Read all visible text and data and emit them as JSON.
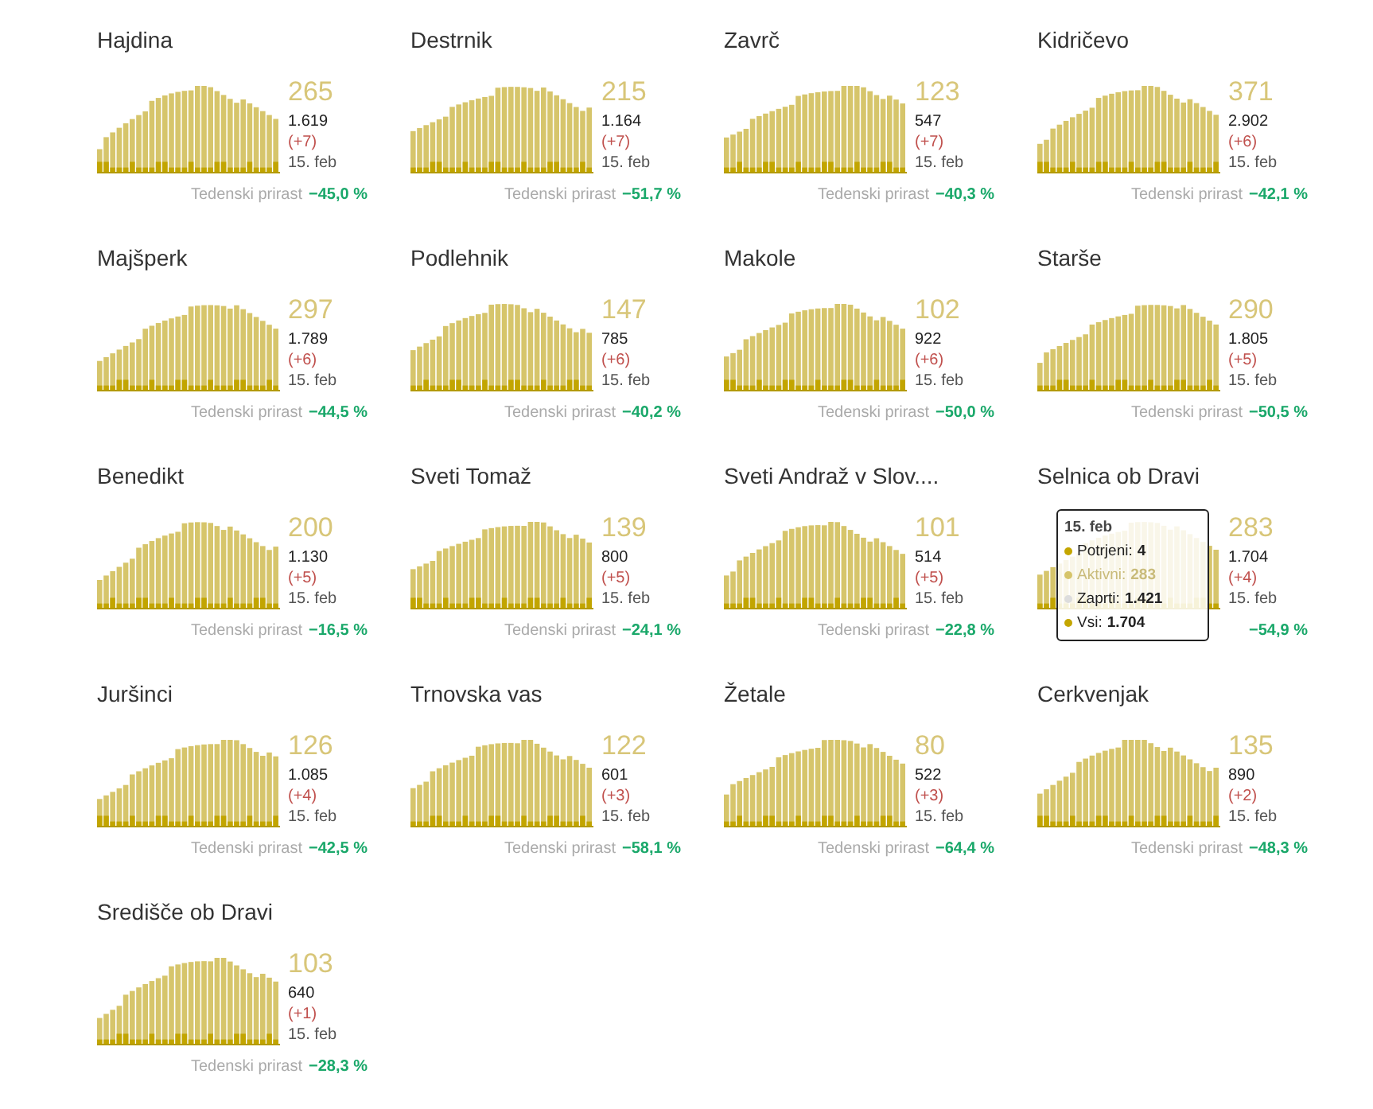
{
  "cards": [
    {
      "title": "Hajdina",
      "active": "265",
      "total": "1.619",
      "delta": "(+7)",
      "date": "15. feb",
      "growth_label": "Tedenski prirast",
      "growth": "−45,0 %"
    },
    {
      "title": "Destrnik",
      "active": "215",
      "total": "1.164",
      "delta": "(+7)",
      "date": "15. feb",
      "growth_label": "Tedenski prirast",
      "growth": "−51,7 %"
    },
    {
      "title": "Zavrč",
      "active": "123",
      "total": "547",
      "delta": "(+7)",
      "date": "15. feb",
      "growth_label": "Tedenski prirast",
      "growth": "−40,3 %"
    },
    {
      "title": "Kidričevo",
      "active": "371",
      "total": "2.902",
      "delta": "(+6)",
      "date": "15. feb",
      "growth_label": "Tedenski prirast",
      "growth": "−42,1 %"
    },
    {
      "title": "Majšperk",
      "active": "297",
      "total": "1.789",
      "delta": "(+6)",
      "date": "15. feb",
      "growth_label": "Tedenski prirast",
      "growth": "−44,5 %"
    },
    {
      "title": "Podlehnik",
      "active": "147",
      "total": "785",
      "delta": "(+6)",
      "date": "15. feb",
      "growth_label": "Tedenski prirast",
      "growth": "−40,2 %"
    },
    {
      "title": "Makole",
      "active": "102",
      "total": "922",
      "delta": "(+6)",
      "date": "15. feb",
      "growth_label": "Tedenski prirast",
      "growth": "−50,0 %"
    },
    {
      "title": "Starše",
      "active": "290",
      "total": "1.805",
      "delta": "(+5)",
      "date": "15. feb",
      "growth_label": "Tedenski prirast",
      "growth": "−50,5 %"
    },
    {
      "title": "Benedikt",
      "active": "200",
      "total": "1.130",
      "delta": "(+5)",
      "date": "15. feb",
      "growth_label": "Tedenski prirast",
      "growth": "−16,5 %"
    },
    {
      "title": "Sveti Tomaž",
      "active": "139",
      "total": "800",
      "delta": "(+5)",
      "date": "15. feb",
      "growth_label": "Tedenski prirast",
      "growth": "−24,1 %"
    },
    {
      "title": "Sveti Andraž v Slov....",
      "active": "101",
      "total": "514",
      "delta": "(+5)",
      "date": "15. feb",
      "growth_label": "Tedenski prirast",
      "growth": "−22,8 %"
    },
    {
      "title": "Selnica ob Dravi",
      "active": "283",
      "total": "1.704",
      "delta": "(+4)",
      "date": "15. feb",
      "growth": "−54,9 %",
      "tooltip": {
        "date": "15. feb",
        "rows": [
          {
            "label": "Potrjeni:",
            "value": "4",
            "color": "#c4a600",
            "faded": false
          },
          {
            "label": "Aktivni:",
            "value": "283",
            "color": "#d6c46a",
            "faded": true
          },
          {
            "label": "Zaprti:",
            "value": "1.421",
            "color": "#dddddd",
            "faded": false
          },
          {
            "label": "Vsi:",
            "value": "1.704",
            "color": "#c4a600",
            "faded": false
          }
        ]
      }
    },
    {
      "title": "Juršinci",
      "active": "126",
      "total": "1.085",
      "delta": "(+4)",
      "date": "15. feb",
      "growth_label": "Tedenski prirast",
      "growth": "−42,5 %"
    },
    {
      "title": "Trnovska vas",
      "active": "122",
      "total": "601",
      "delta": "(+3)",
      "date": "15. feb",
      "growth_label": "Tedenski prirast",
      "growth": "−58,1 %"
    },
    {
      "title": "Žetale",
      "active": "80",
      "total": "522",
      "delta": "(+3)",
      "date": "15. feb",
      "growth_label": "Tedenski prirast",
      "growth": "−64,4 %"
    },
    {
      "title": "Cerkvenjak",
      "active": "135",
      "total": "890",
      "delta": "(+2)",
      "date": "15. feb",
      "growth_label": "Tedenski prirast",
      "growth": "−48,3 %"
    },
    {
      "title": "Središče ob Dravi",
      "active": "103",
      "total": "640",
      "delta": "(+1)",
      "date": "15. feb",
      "growth_label": "Tedenski prirast",
      "growth": "−28,3 %"
    }
  ]
}
